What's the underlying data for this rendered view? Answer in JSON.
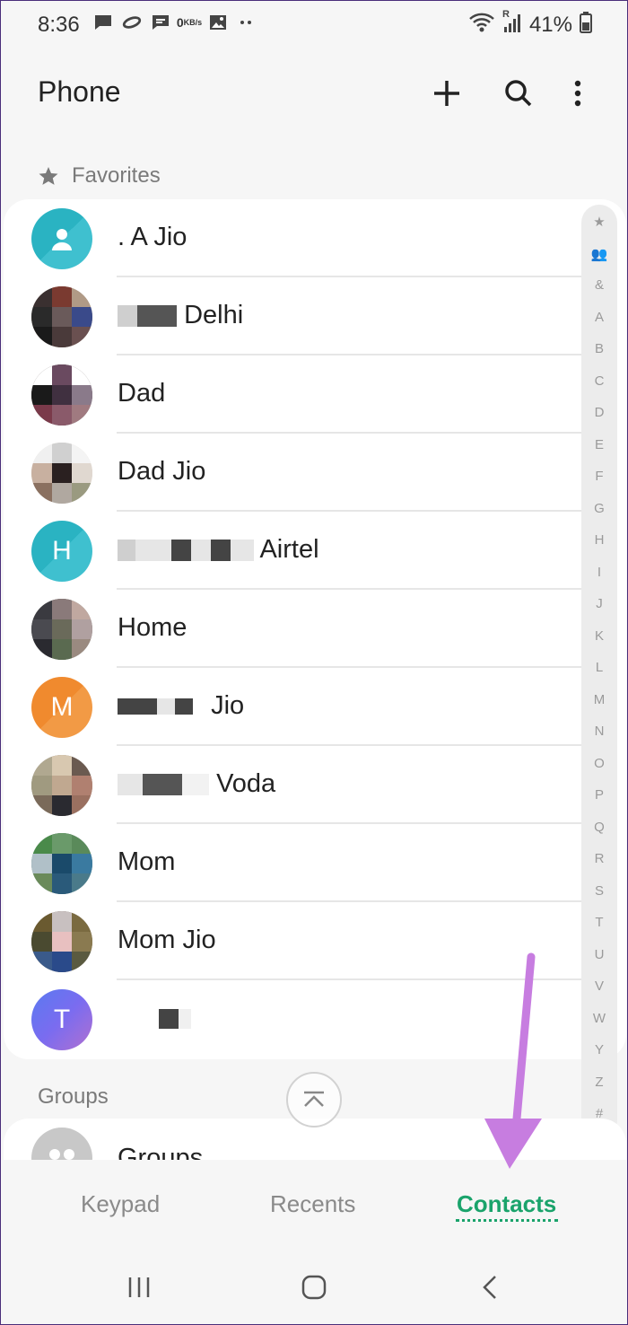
{
  "status_bar": {
    "time": "8:36",
    "kbs_value": "0",
    "kbs_unit": "KB/s",
    "roaming": "R",
    "battery": "41%"
  },
  "app_bar": {
    "title": "Phone",
    "icons": [
      "add-icon",
      "search-icon",
      "more-vert-icon"
    ]
  },
  "favorites": {
    "header": "Favorites",
    "contacts": [
      {
        "name": ". A Jio",
        "avatar": "person-icon",
        "color": "#2ab3c2"
      },
      {
        "name": "Delhi",
        "avatar": "photo"
      },
      {
        "name": "Dad",
        "avatar": "photo"
      },
      {
        "name": "Dad Jio",
        "avatar": "photo"
      },
      {
        "name": "Airtel",
        "avatar_letter": "H",
        "color": "#2ab3c2"
      },
      {
        "name": "Home",
        "avatar": "photo"
      },
      {
        "name": "Jio",
        "avatar_letter": "M",
        "color": "#f08a2e"
      },
      {
        "name": "Voda",
        "avatar": "photo"
      },
      {
        "name": "Mom",
        "avatar": "photo"
      },
      {
        "name": "Mom Jio",
        "avatar": "photo"
      },
      {
        "name": "",
        "avatar_letter": "T",
        "color": "#7a6cf0"
      }
    ]
  },
  "index_letters": [
    "★",
    "👥",
    "&",
    "A",
    "B",
    "C",
    "D",
    "E",
    "F",
    "G",
    "H",
    "I",
    "J",
    "K",
    "L",
    "M",
    "N",
    "O",
    "P",
    "Q",
    "R",
    "S",
    "T",
    "U",
    "V",
    "W",
    "Y",
    "Z",
    "#"
  ],
  "groups": {
    "header": "Groups",
    "item": "Groups"
  },
  "tabs": [
    {
      "label": "Keypad",
      "active": false
    },
    {
      "label": "Recents",
      "active": false
    },
    {
      "label": "Contacts",
      "active": true
    }
  ],
  "colors": {
    "accent": "#1aa36b",
    "annotation_arrow": "#c77de0"
  }
}
